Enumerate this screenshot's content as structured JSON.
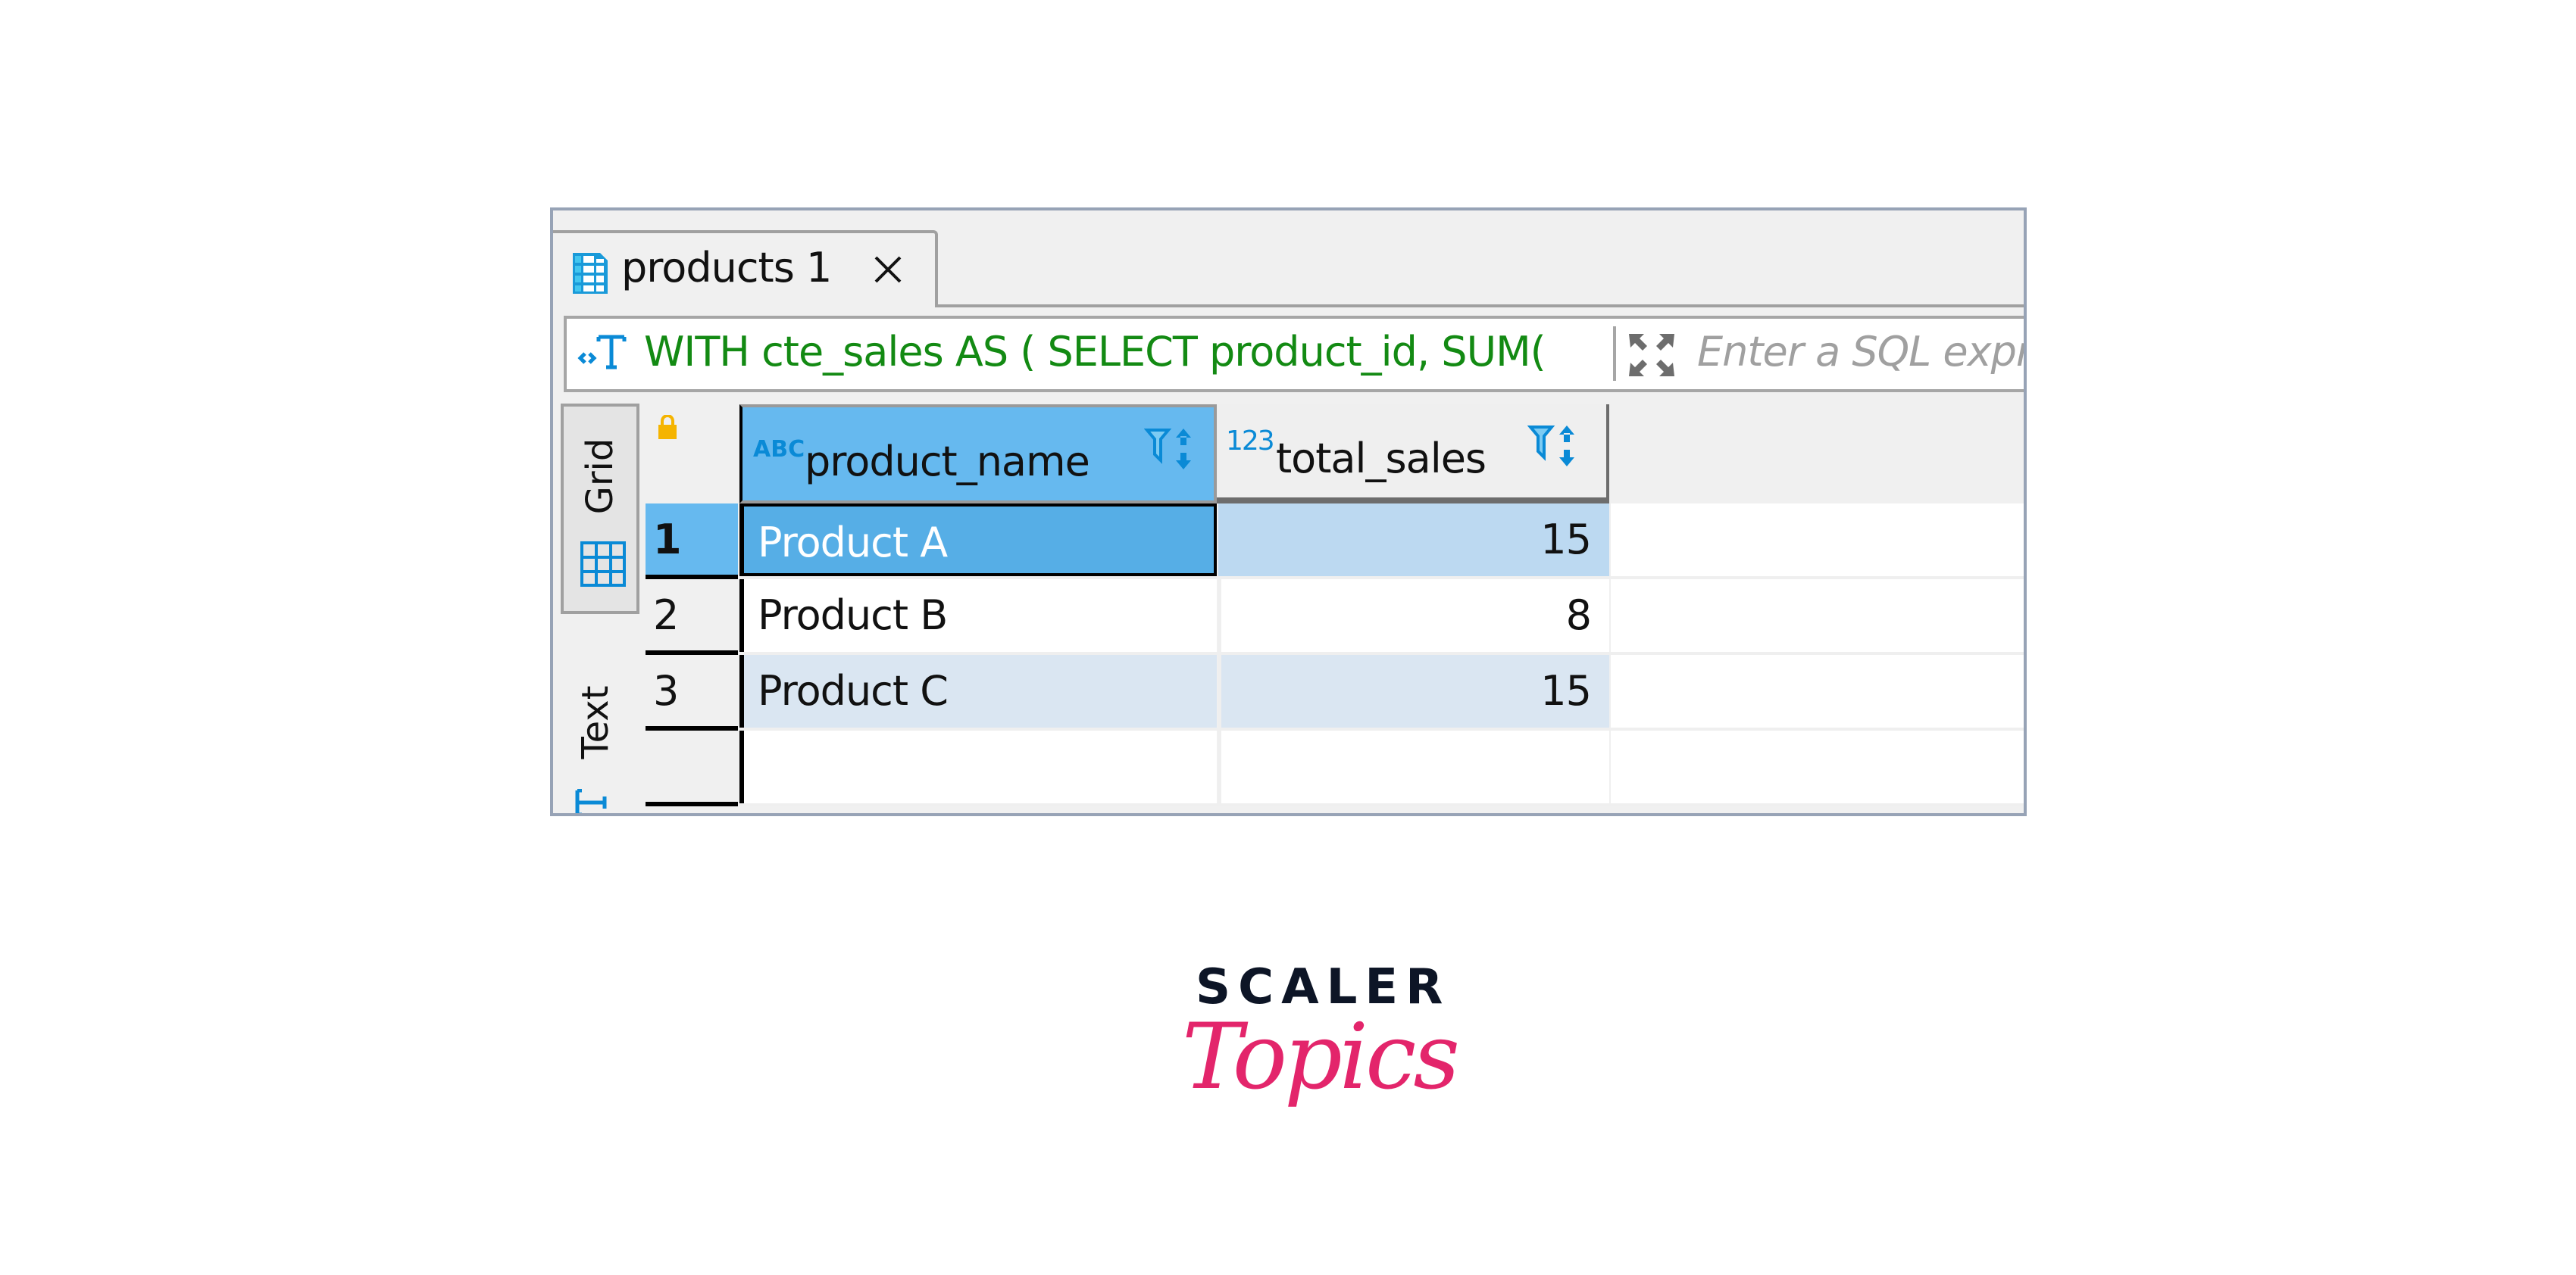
{
  "tab": {
    "label": "products 1",
    "icon": "table-icon",
    "close_icon": "close-icon"
  },
  "sql_bar": {
    "query": "WITH cte_sales AS ( SELECT product_id, SUM(",
    "filter_placeholder": "Enter a SQL expr",
    "query_icon": "sql-text-icon",
    "expand_icon": "expand-icon"
  },
  "side_tabs": [
    {
      "label": "Grid",
      "icon": "grid-icon",
      "active": true
    },
    {
      "label": "Text",
      "icon": "text-icon",
      "active": false
    }
  ],
  "grid": {
    "columns": [
      {
        "name": "product_name",
        "type_badge": "ABC",
        "selected": true
      },
      {
        "name": "total_sales",
        "type_badge": "123",
        "selected": false
      }
    ],
    "rows": [
      {
        "num": "1",
        "product_name": "Product A",
        "total_sales": "15",
        "selected": true
      },
      {
        "num": "2",
        "product_name": "Product B",
        "total_sales": "8",
        "selected": false
      },
      {
        "num": "3",
        "product_name": "Product C",
        "total_sales": "15",
        "selected": false
      }
    ]
  },
  "colors": {
    "selected_header": "#66b9ef",
    "selected_cell": "#56aee6",
    "row_highlight": "#bcd9f1",
    "alt_row": "#dae6f2",
    "sql_text": "#138a13",
    "accent_icon": "#0a8ad6"
  },
  "logo": {
    "brand": "SCALER",
    "sub": "Topics"
  }
}
